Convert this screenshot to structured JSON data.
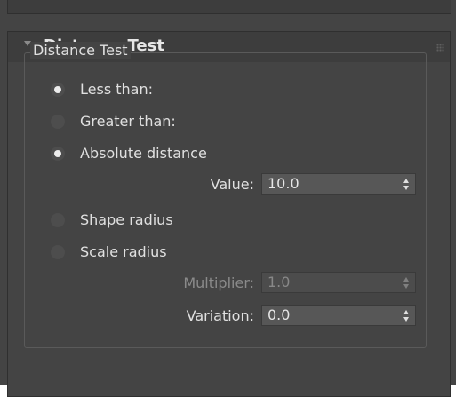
{
  "rollout": {
    "title": "Distance Test",
    "icons": {
      "collapse": "triangle-down-icon",
      "grip": "grip-dots-icon"
    }
  },
  "group": {
    "legend": "Distance Test"
  },
  "radios": [
    {
      "label": "Less than:",
      "checked": true
    },
    {
      "label": "Greater than:",
      "checked": false
    },
    {
      "label": "Absolute distance",
      "checked": true
    },
    {
      "label": "Shape radius",
      "checked": false
    },
    {
      "label": "Scale radius",
      "checked": false
    }
  ],
  "fields": {
    "value": {
      "label": "Value:",
      "value": "10.0",
      "enabled": true
    },
    "multiplier": {
      "label": "Multiplier:",
      "value": "1.0",
      "enabled": false
    },
    "variation": {
      "label": "Variation:",
      "value": "0.0",
      "enabled": true
    }
  },
  "colors": {
    "panel": "#444444",
    "header": "#3d3d3d",
    "input": "#575757",
    "text": "#e0e0e0",
    "disabled_text": "#8a8a8a"
  }
}
